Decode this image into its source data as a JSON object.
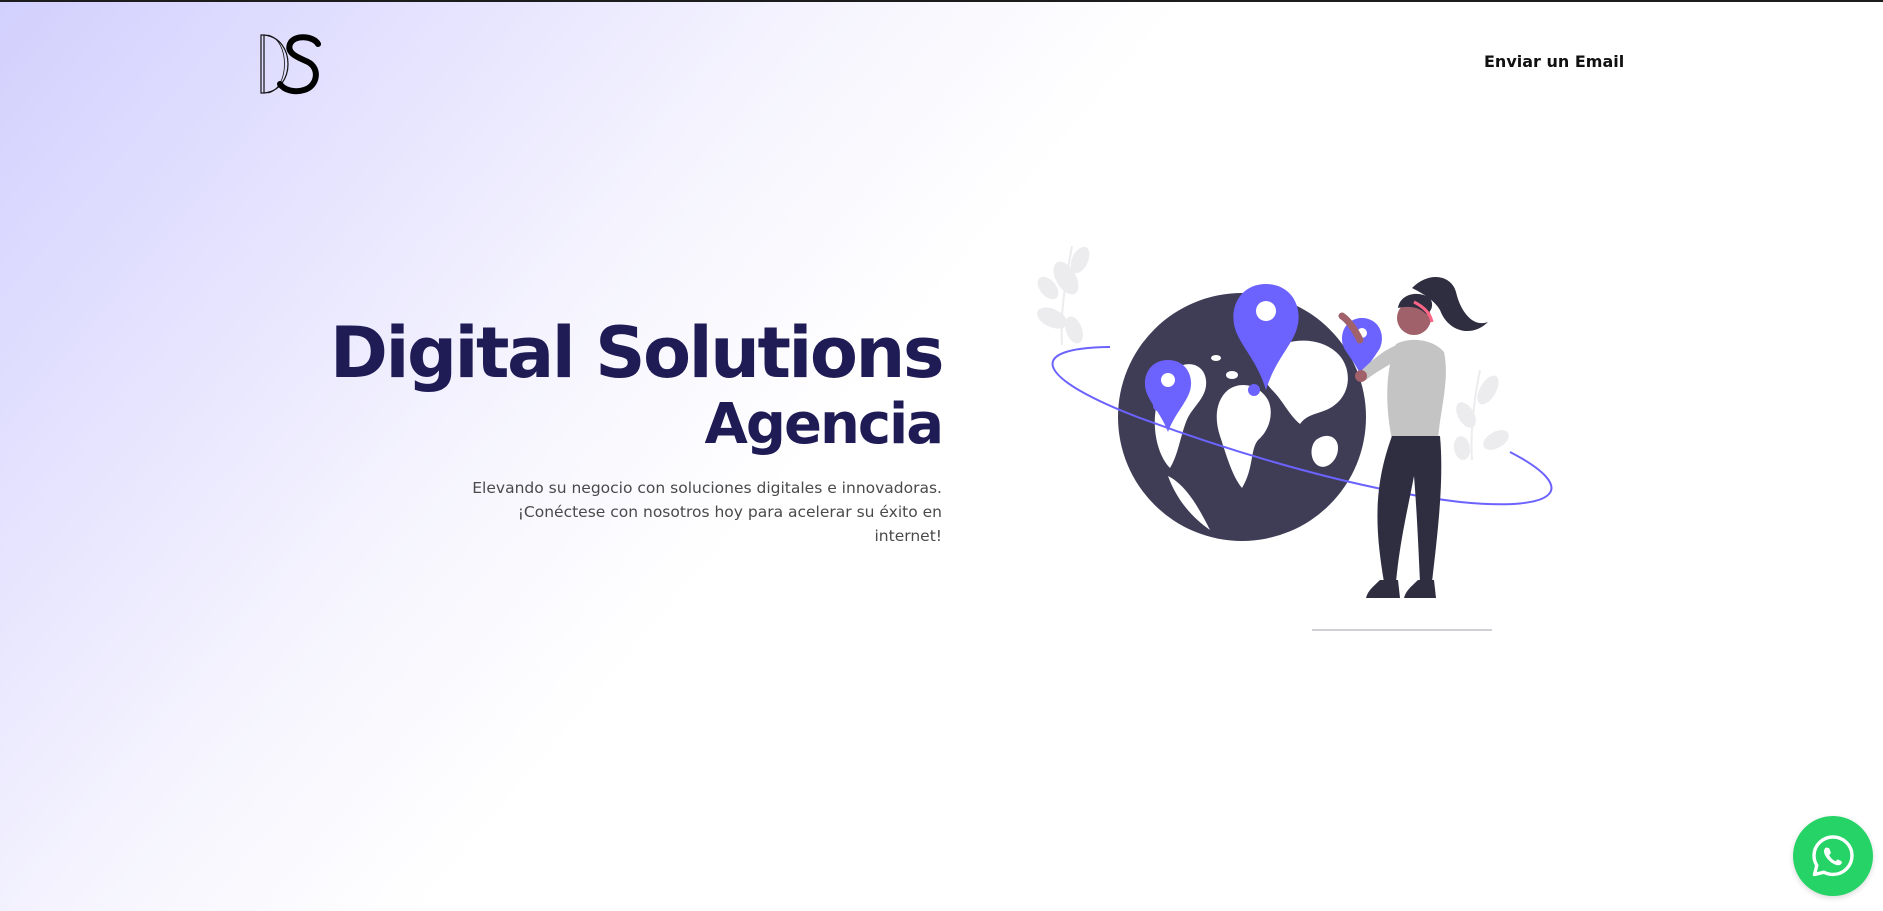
{
  "header": {
    "logo_alt": "DS",
    "nav_link": "Enviar un Email"
  },
  "hero": {
    "title": "Digital Solutions",
    "subtitle": "Agencia",
    "description": "Elevando su negocio con soluciones digitales e innovadoras. ¡Conéctese con nosotros hoy para acelerar su éxito en internet!"
  },
  "floating": {
    "whatsapp_icon": "whatsapp-icon"
  },
  "colors": {
    "title": "#1f1b55",
    "accent": "#6c63ff",
    "globe": "#3f3d56",
    "whatsapp": "#25d366"
  }
}
